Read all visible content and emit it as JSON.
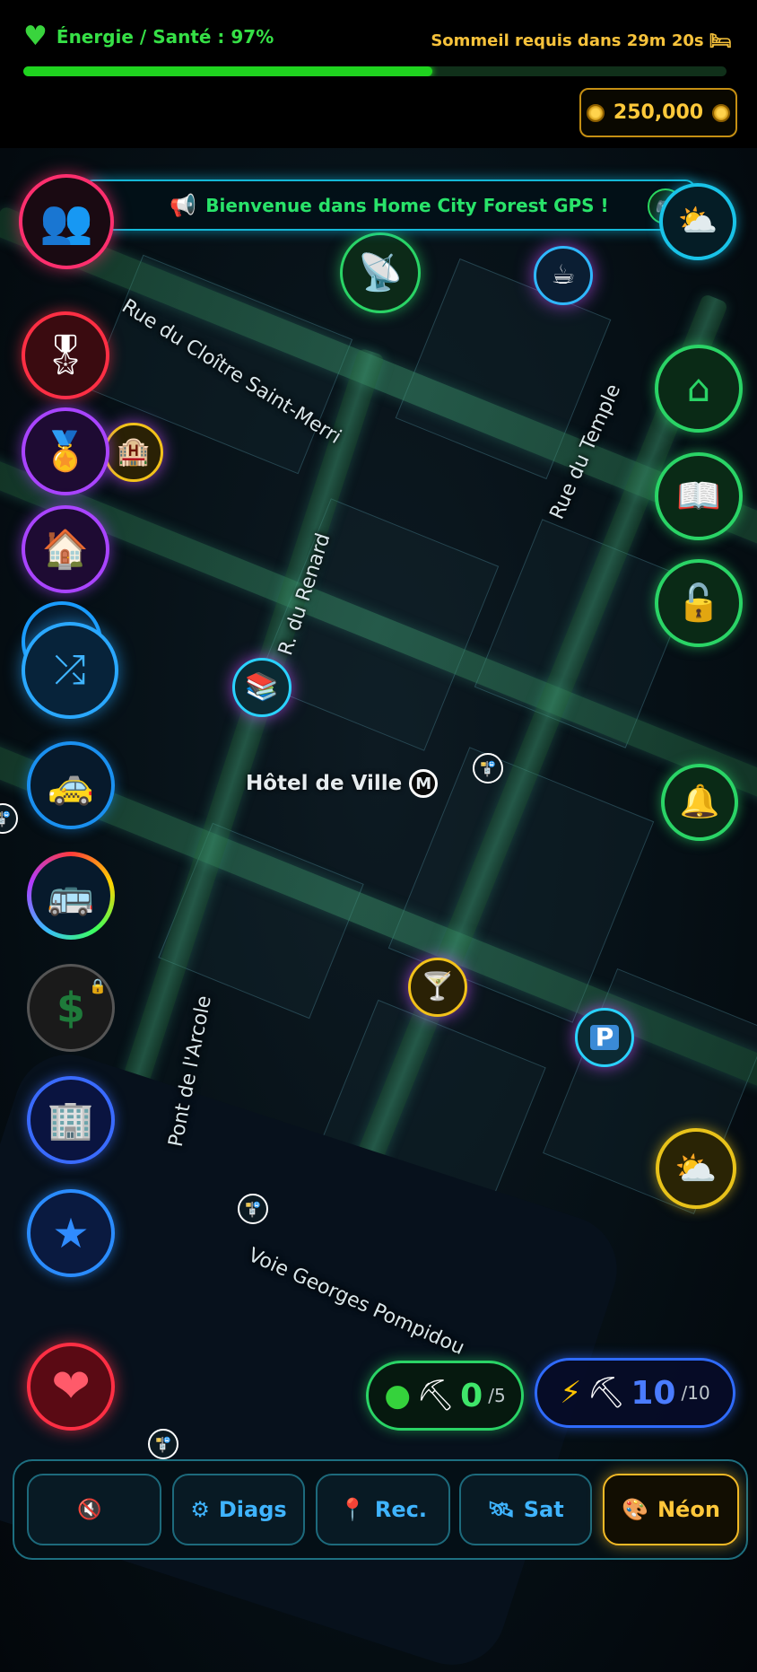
{
  "status": {
    "energy_label": "Énergie / Santé : 97%",
    "energy_percent": 97,
    "sleep_label": "Sommeil requis dans 29m 20s",
    "coins": "250,000"
  },
  "banner": {
    "text": "Bienvenue dans Home City Forest GPS !"
  },
  "map": {
    "streets": [
      "Rue du Cloître Saint-Merri",
      "R. du Renard",
      "Rue du Temple",
      "Pont de l'Arcole",
      "Voie Georges Pompidou"
    ],
    "place_label": "Hôtel de Ville",
    "metro_symbol": "M"
  },
  "icons": {
    "left": [
      "friends-icon",
      "medal-icon",
      "gold-medal-icon",
      "home-icon",
      "crossed-arrows-icon",
      "taxi-icon",
      "bus-icon",
      "dollar-icon",
      "buildings-icon",
      "star-icon",
      "heart-icon"
    ],
    "right": [
      "weather-icon",
      "house-icon",
      "map-book-icon",
      "lock-icon",
      "bell-icon",
      "sun-cloud-icon"
    ],
    "markers": [
      "antenna-icon",
      "coffee-icon",
      "hotel-icon",
      "library-icon",
      "cocktail-icon",
      "parking-icon"
    ]
  },
  "mining": {
    "green": {
      "value": "0",
      "max": "/5"
    },
    "energy": {
      "value": "10",
      "max": "/10"
    }
  },
  "nav": {
    "tabs": [
      {
        "label": "",
        "icon": "mute-icon"
      },
      {
        "label": "Diags",
        "icon": "gear-icon"
      },
      {
        "label": "Rec.",
        "icon": "pin-icon"
      },
      {
        "label": "Sat",
        "icon": "satellite-icon"
      },
      {
        "label": "Néon",
        "icon": "palette-icon"
      }
    ],
    "active": "Néon"
  },
  "colors": {
    "accent": "#1fd31f",
    "coin": "#ffc93a",
    "neon_cyan": "#14b8d8",
    "active_tab": "#f2b926"
  }
}
